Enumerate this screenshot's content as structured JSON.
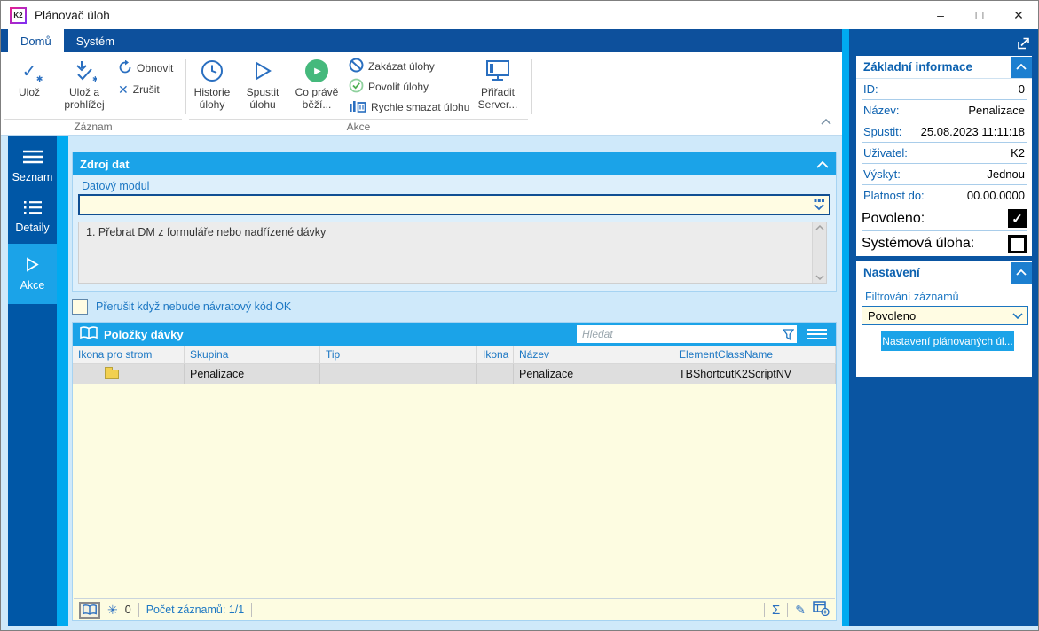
{
  "window": {
    "title": "Plánovač úloh",
    "logo_text": "K2",
    "minimize_glyph": "–",
    "maximize_glyph": "□",
    "close_glyph": "✕"
  },
  "ribbon": {
    "tabs": [
      {
        "label": "Domů",
        "active": true
      },
      {
        "label": "Systém",
        "active": false
      }
    ],
    "groups": [
      {
        "label": "Záznam"
      },
      {
        "label": "Akce"
      }
    ],
    "buttons": {
      "save": "Ulož",
      "save_and_view": "Ulož a prohlížej",
      "refresh": "Obnovit",
      "cancel": "Zrušit",
      "task_history": "Historie úlohy",
      "run_task": "Spustit úlohu",
      "whats_running": "Co právě běží...",
      "disable_tasks": "Zakázat úlohy",
      "enable_tasks": "Povolit úlohy",
      "quick_delete_task": "Rychle smazat úlohu",
      "assign_server": "Přiřadit Server..."
    }
  },
  "sidebar": {
    "items": [
      {
        "label": "Seznam",
        "icon": "menu-icon",
        "active": false
      },
      {
        "label": "Detaily",
        "icon": "list-icon",
        "active": false
      },
      {
        "label": "Akce",
        "icon": "play-icon",
        "active": true
      }
    ]
  },
  "zdroj_dat": {
    "title": "Zdroj dat",
    "field_label": "Datový modul",
    "field_value": "",
    "list_items": [
      "1. Přebrat DM z formuláře nebo nadřízené dávky"
    ]
  },
  "interrupt_checkbox": {
    "label": "Přerušit když nebude návratový kód OK",
    "checked": false
  },
  "polozky_davky": {
    "title": "Položky dávky",
    "search_placeholder": "Hledat",
    "columns": [
      "Ikona pro strom",
      "Skupina",
      "Tip",
      "Ikona",
      "Název",
      "ElementClassName"
    ],
    "rows": [
      {
        "ikona_pro_strom": "folder-icon",
        "skupina": "Penalizace",
        "tip": "",
        "ikona": "",
        "nazev": "Penalizace",
        "element_class_name": "TBShortcutK2ScriptNV"
      }
    ],
    "status": {
      "star_count": "0",
      "records": "Počet záznamů: 1/1"
    }
  },
  "right_panel": {
    "basic_info": {
      "title": "Základní informace",
      "fields": [
        {
          "label": "ID:",
          "value": "0"
        },
        {
          "label": "Název:",
          "value": "Penalizace"
        },
        {
          "label": "Spustit:",
          "value": "25.08.2023 11:11:18"
        },
        {
          "label": "Uživatel:",
          "value": "K2"
        },
        {
          "label": "Výskyt:",
          "value": "Jednou"
        },
        {
          "label": "Platnost do:",
          "value": "00.00.0000"
        }
      ],
      "checks": [
        {
          "label": "Povoleno:",
          "checked": true
        },
        {
          "label": "Systémová úloha:",
          "checked": false
        }
      ]
    },
    "settings": {
      "title": "Nastavení",
      "filter_label": "Filtrování záznamů",
      "filter_value": "Povoleno",
      "button": "Nastavení plánovaných úl..."
    }
  },
  "colors": {
    "accent_cyan": "#1ba3e8",
    "stripe_cyan": "#00aaf0",
    "tabbar_blue": "#0d509c",
    "sidebar_blue": "#0057a6",
    "right_panel_blue": "#0a55a2",
    "main_bg": "#cfe9fa",
    "input_yellow": "#fffce3",
    "table_cream": "#fdfce1",
    "icon_blue": "#2a6fc0",
    "green": "#45b97c"
  }
}
